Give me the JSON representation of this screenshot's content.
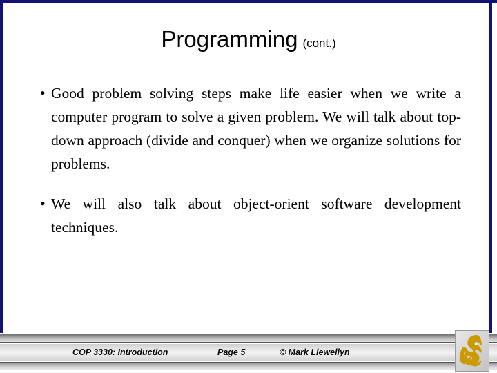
{
  "slide": {
    "title": {
      "main": "Programming",
      "suffix": "(cont.)"
    },
    "bullets": [
      {
        "marker": "•",
        "text": "Good problem solving steps make life easier when we write a computer program to solve a given problem. We will talk about top-down approach (divide and conquer) when we organize solutions for problems."
      },
      {
        "marker": "•",
        "text": "We will also talk about object-orient software development techniques."
      }
    ],
    "footer": {
      "course": "COP 3330:  Introduction",
      "page": "Page 5",
      "copyright": "© Mark Llewellyn",
      "logo_name": "ucf-pegasus-logo"
    },
    "colors": {
      "border_navy": "#111176",
      "background": "#ffffff",
      "text": "#000000",
      "logo_gold": "#cc9900",
      "footer_band": "#e9e9e9"
    }
  }
}
